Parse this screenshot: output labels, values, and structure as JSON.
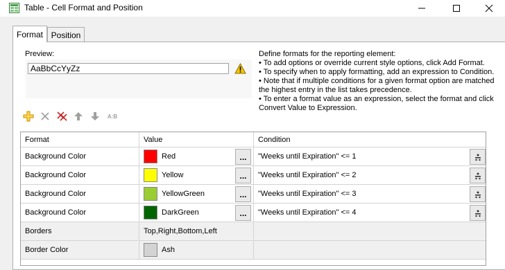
{
  "window": {
    "title": "Table - Cell Format and Position",
    "minimize_icon": "minimize-icon",
    "maximize_icon": "maximize-icon",
    "close_icon": "close-icon"
  },
  "tabs": [
    {
      "label": "Format",
      "active": true
    },
    {
      "label": "Position",
      "active": false
    }
  ],
  "preview": {
    "label": "Preview:",
    "sample_text": "AaBbCcYyZz",
    "warning_icon": "warning-icon"
  },
  "help_lines": [
    "Define formats for the reporting element:",
    "• To add options or override current style options, click Add Format.",
    "• To specify when to apply formatting, add an expression to Condition.",
    "• Note that if multiple conditions for a given format option are matched the highest entry in the list takes precedence.",
    "• To enter a format value as an expression, select the format and click Convert Value to Expression."
  ],
  "toolbar": {
    "icons": [
      "add-icon",
      "delete-icon",
      "delete-all-icon",
      "move-up-icon",
      "move-down-icon",
      "convert-expression-icon"
    ],
    "convert_label": "A:B"
  },
  "grid": {
    "headers": {
      "format": "Format",
      "value": "Value",
      "condition": "Condition"
    },
    "ellipsis": "...",
    "rows": [
      {
        "format": "Background Color",
        "value": "Red",
        "color": "#ff0000",
        "condition": "\"Weeks until Expiration\" <= 1"
      },
      {
        "format": "Background Color",
        "value": "Yellow",
        "color": "#ffff00",
        "condition": "\"Weeks until Expiration\" <= 2"
      },
      {
        "format": "Background Color",
        "value": "YellowGreen",
        "color": "#9acd32",
        "condition": "\"Weeks until Expiration\" <= 3"
      },
      {
        "format": "Background Color",
        "value": "DarkGreen",
        "color": "#006400",
        "condition": "\"Weeks until Expiration\" <= 4"
      },
      {
        "format": "Borders",
        "value": "Top,Right,Bottom,Left",
        "condition": ""
      },
      {
        "format": "Border Color",
        "value": "Ash",
        "color": "#d3d3d3",
        "condition": ""
      }
    ]
  }
}
